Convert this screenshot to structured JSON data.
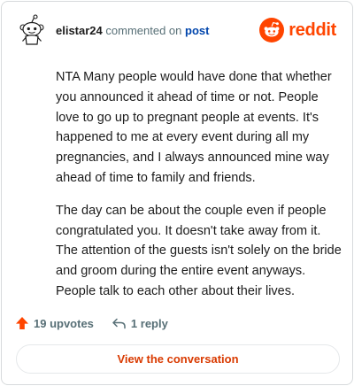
{
  "header": {
    "username": "elistar24",
    "action_text": "commented on",
    "post_link": "post",
    "brand": "reddit"
  },
  "comment": {
    "paragraphs": [
      "NTA Many people would have done that whether you announced it ahead of time or not. People love to go up to pregnant people at events. It's happened to me at every event during all my pregnancies, and I always announced mine way ahead of time to family and friends.",
      "The day can be about the couple even if people congratulated you. It doesn't take away from it. The attention of the guests isn't solely on the bride and groom during the entire event anyways. People talk to each other about their lives."
    ]
  },
  "actions": {
    "upvotes_label": "19 upvotes",
    "reply_label": "1 reply"
  },
  "footer": {
    "button_label": "View the conversation"
  },
  "colors": {
    "brand": "#ff4500",
    "link": "#0045ac",
    "button_text": "#d93a00"
  },
  "icons": {
    "avatar": "snoo-avatar-icon",
    "logo": "reddit-logo-icon",
    "upvote": "upvote-arrow-icon",
    "reply": "reply-arrow-icon"
  }
}
